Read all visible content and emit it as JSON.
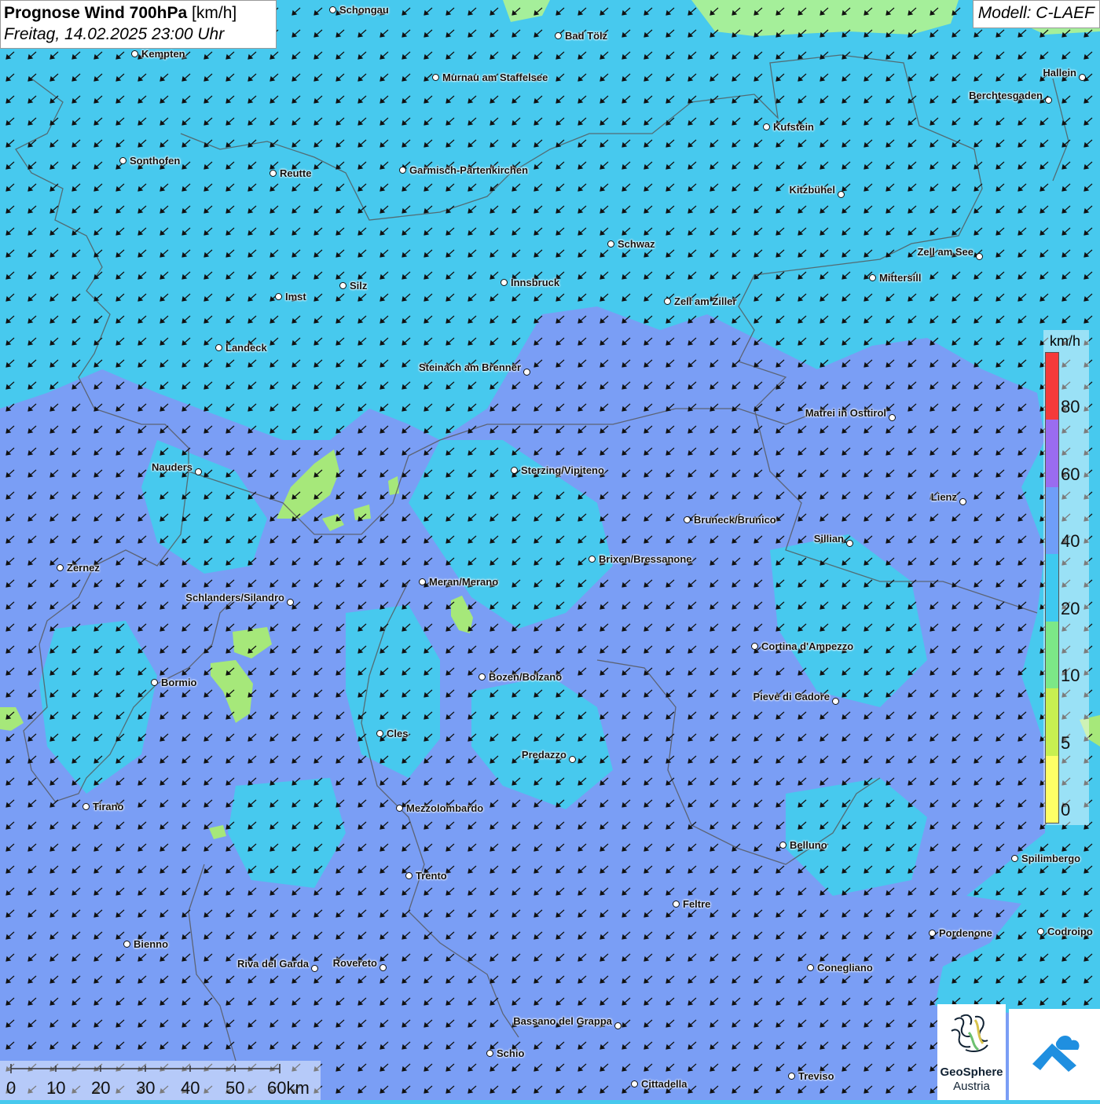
{
  "header": {
    "title_bold": "Prognose Wind 700hPa",
    "title_unit": "[km/h]",
    "subtitle": "Freitag, 14.02.2025 23:00 Uhr",
    "model": "Modell: C-LAEF"
  },
  "cities": [
    {
      "name": "Schongau",
      "side": "right"
    },
    {
      "name": "Bad Tölz",
      "side": "right"
    },
    {
      "name": "Kempten",
      "side": "right"
    },
    {
      "name": "Murnau am Staffelsee",
      "side": "right"
    },
    {
      "name": "Hallein",
      "side": "left"
    },
    {
      "name": "Berchtesgaden",
      "side": "left"
    },
    {
      "name": "Kufstein",
      "side": "right"
    },
    {
      "name": "Sonthofen",
      "side": "right"
    },
    {
      "name": "Reutte",
      "side": "right"
    },
    {
      "name": "Garmisch-Partenkirchen",
      "side": "right"
    },
    {
      "name": "Kitzbühel",
      "side": "left"
    },
    {
      "name": "Schwaz",
      "side": "right"
    },
    {
      "name": "Zell am See",
      "side": "left"
    },
    {
      "name": "Mittersill",
      "side": "right"
    },
    {
      "name": "Innsbruck",
      "side": "right"
    },
    {
      "name": "Silz",
      "side": "right"
    },
    {
      "name": "Imst",
      "side": "right"
    },
    {
      "name": "Zell am Ziller",
      "side": "right"
    },
    {
      "name": "Landeck",
      "side": "right"
    },
    {
      "name": "Steinach am Brenner",
      "side": "left"
    },
    {
      "name": "Matrei in Osttirol",
      "side": "left"
    },
    {
      "name": "Nauders",
      "side": "left"
    },
    {
      "name": "Sterzing/Vipiteno",
      "side": "right"
    },
    {
      "name": "Lienz",
      "side": "left"
    },
    {
      "name": "Bruneck/Brunico",
      "side": "right"
    },
    {
      "name": "Sillian",
      "side": "left"
    },
    {
      "name": "Zernez",
      "side": "right"
    },
    {
      "name": "Brixen/Bressanone",
      "side": "right"
    },
    {
      "name": "Meran/Merano",
      "side": "right"
    },
    {
      "name": "Schlanders/Silandro",
      "side": "left"
    },
    {
      "name": "Cortina d'Ampezzo",
      "side": "right"
    },
    {
      "name": "Bozen/Bolzano",
      "side": "right"
    },
    {
      "name": "Bormio",
      "side": "right"
    },
    {
      "name": "Pieve di Cadore",
      "side": "left"
    },
    {
      "name": "Cles",
      "side": "right"
    },
    {
      "name": "Predazzo",
      "side": "left"
    },
    {
      "name": "Tirano",
      "side": "right"
    },
    {
      "name": "Mezzolombardo",
      "side": "right"
    },
    {
      "name": "Belluno",
      "side": "right"
    },
    {
      "name": "Spilimbergo",
      "side": "right"
    },
    {
      "name": "Trento",
      "side": "right"
    },
    {
      "name": "Feltre",
      "side": "right"
    },
    {
      "name": "Pordenone",
      "side": "right"
    },
    {
      "name": "Codroipo",
      "side": "right"
    },
    {
      "name": "Bienno",
      "side": "right"
    },
    {
      "name": "Riva del Garda",
      "side": "left"
    },
    {
      "name": "Rovereto",
      "side": "left"
    },
    {
      "name": "Conegliano",
      "side": "right"
    },
    {
      "name": "Bassano del Grappa",
      "side": "left"
    },
    {
      "name": "Schio",
      "side": "right"
    },
    {
      "name": "Treviso",
      "side": "right"
    },
    {
      "name": "Cittadella",
      "side": "right"
    }
  ],
  "legend": {
    "unit": "km/h",
    "colors": [
      "#ffff66",
      "#c8f050",
      "#7ce887",
      "#3ec9f0",
      "#6f9ef8",
      "#9a6cf0",
      "#f53a3a"
    ],
    "ticks": [
      "0",
      "5",
      "10",
      "20",
      "40",
      "60",
      "80"
    ]
  },
  "scalebar": {
    "labels": [
      "0",
      "10",
      "20",
      "30",
      "40",
      "50",
      "60km"
    ]
  },
  "wind": {
    "direction": "north-east",
    "field_colors": {
      "base": "#47c9ee",
      "stronger": "#7d9cf4",
      "weak": "#a6e87a",
      "land_green": "#a5ef9a"
    }
  },
  "logos": {
    "geosphere_line1": "GeoSphere",
    "geosphere_line2": "Austria"
  }
}
